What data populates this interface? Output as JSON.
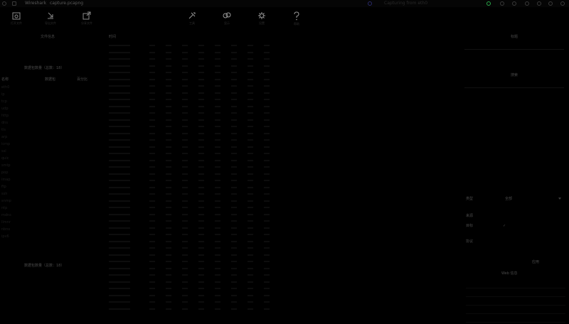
{
  "window": {
    "title": "Wireshark",
    "file_label": "capture.pcapng",
    "status_center": "Capturing from eth0"
  },
  "toolbar": [
    {
      "label": "打开文件",
      "icon": "open-folder-icon"
    },
    {
      "label": "导出文件",
      "icon": "export-icon"
    },
    {
      "label": "分享文件",
      "icon": "share-icon"
    },
    {
      "label": "工具",
      "icon": "tools-icon"
    },
    {
      "label": "显示",
      "icon": "display-icon"
    },
    {
      "label": "设置",
      "icon": "gear-icon"
    },
    {
      "label": "帮助",
      "icon": "help-icon"
    }
  ],
  "left_panel": {
    "section_title": "文件信息",
    "top_group": "数据包数量（总数：18）",
    "columns": [
      "名称",
      "数据包",
      "百分比"
    ],
    "rows": [
      [
        "eth0",
        "",
        ""
      ],
      [
        "ip",
        "",
        ""
      ],
      [
        "tcp",
        "",
        ""
      ],
      [
        "udp",
        "",
        ""
      ],
      [
        "http",
        "",
        ""
      ],
      [
        "dns",
        "",
        ""
      ],
      [
        "tls",
        "",
        ""
      ],
      [
        "arp",
        "",
        ""
      ],
      [
        "icmp",
        "",
        ""
      ],
      [
        "ssl",
        "",
        ""
      ],
      [
        "quic",
        "",
        ""
      ],
      [
        "smtp",
        "",
        ""
      ],
      [
        "pop",
        "",
        ""
      ],
      [
        "imap",
        "",
        ""
      ],
      [
        "ftp",
        "",
        ""
      ],
      [
        "ssh",
        "",
        ""
      ],
      [
        "snmp",
        "",
        ""
      ],
      [
        "ntp",
        "",
        ""
      ],
      [
        "mdns",
        "",
        ""
      ],
      [
        "llmnr",
        "",
        ""
      ],
      [
        "nbns",
        "",
        ""
      ],
      [
        "ipv6",
        "",
        ""
      ]
    ],
    "bottom_group": "数据包数量（总数：18）"
  },
  "center_panel": {
    "title": "时间",
    "row_count": 40
  },
  "right_panel": {
    "header": "标题",
    "subheader": "搜索",
    "rows": [
      {
        "label": "类型",
        "value": "全部"
      },
      {
        "label": "来源",
        "value": ""
      },
      {
        "label": "目标",
        "value": ""
      },
      {
        "label": "协议",
        "value": ""
      }
    ],
    "apply": "应用",
    "web_section": "Web 信息",
    "web_lines": [
      "",
      "",
      "",
      "",
      ""
    ]
  },
  "colors": {
    "background": "#000000",
    "accent_green": "#2aa84a"
  }
}
